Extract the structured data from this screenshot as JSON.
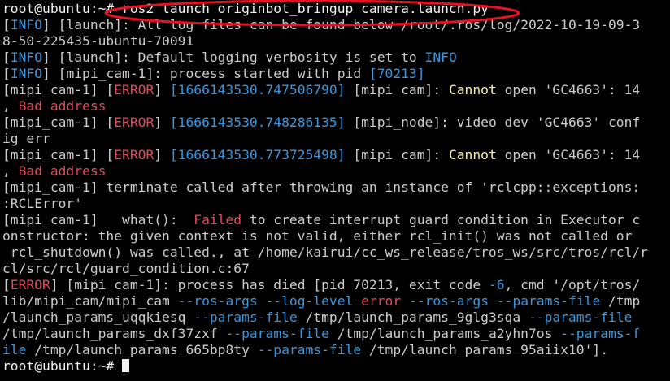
{
  "colors": {
    "background": "#000000",
    "default_text": "#cccccc",
    "bright_text": "#f2f2f2",
    "cyan": "#3a96dd",
    "red": "#e74856",
    "yellow": "#f9f1a5",
    "annotation_red": "#e81123"
  },
  "terminal": {
    "lines": [
      [
        {
          "t": "root@ubuntu:~# ",
          "c": "prompt"
        },
        {
          "t": "ros2 launch originbot_bringup camera.launch.py",
          "c": "white"
        }
      ],
      [
        {
          "t": "[",
          "c": "default"
        },
        {
          "t": "INFO",
          "c": "cyan"
        },
        {
          "t": "] [launch]: All log files can be found below /root/.ros/log/2022-10-19-09-3",
          "c": "default"
        }
      ],
      [
        {
          "t": "8-50-225435-ubuntu-70091",
          "c": "default"
        }
      ],
      [
        {
          "t": "[",
          "c": "default"
        },
        {
          "t": "INFO",
          "c": "cyan"
        },
        {
          "t": "] [launch]: Default logging verbosity is set to ",
          "c": "default"
        },
        {
          "t": "INFO",
          "c": "cyan"
        }
      ],
      [
        {
          "t": "[",
          "c": "default"
        },
        {
          "t": "INFO",
          "c": "cyan"
        },
        {
          "t": "] [mipi_cam-1]: process started with pid ",
          "c": "default"
        },
        {
          "t": "[70213]",
          "c": "cyan"
        }
      ],
      [
        {
          "t": "[mipi_cam-1] [",
          "c": "default"
        },
        {
          "t": "ERROR",
          "c": "red"
        },
        {
          "t": "] ",
          "c": "default"
        },
        {
          "t": "[1666143530.747506790]",
          "c": "cyan"
        },
        {
          "t": " [mipi_cam]: ",
          "c": "default"
        },
        {
          "t": "Cannot",
          "c": "yellow"
        },
        {
          "t": " open 'GC4663': 14",
          "c": "default"
        }
      ],
      [
        {
          "t": ", ",
          "c": "default"
        },
        {
          "t": "Bad address",
          "c": "red"
        }
      ],
      [
        {
          "t": "[mipi_cam-1] [",
          "c": "default"
        },
        {
          "t": "ERROR",
          "c": "red"
        },
        {
          "t": "] ",
          "c": "default"
        },
        {
          "t": "[1666143530.748286135]",
          "c": "cyan"
        },
        {
          "t": " [mipi_node]: video dev 'GC4663' conf",
          "c": "default"
        }
      ],
      [
        {
          "t": "ig err",
          "c": "default"
        }
      ],
      [
        {
          "t": "[mipi_cam-1] [",
          "c": "default"
        },
        {
          "t": "ERROR",
          "c": "red"
        },
        {
          "t": "] ",
          "c": "default"
        },
        {
          "t": "[1666143530.773725498]",
          "c": "cyan"
        },
        {
          "t": " [mipi_cam]: ",
          "c": "default"
        },
        {
          "t": "Cannot",
          "c": "yellow"
        },
        {
          "t": " open 'GC4663': 14",
          "c": "default"
        }
      ],
      [
        {
          "t": ", ",
          "c": "default"
        },
        {
          "t": "Bad address",
          "c": "red"
        }
      ],
      [
        {
          "t": "[mipi_cam-1] terminate called after throwing an instance of 'rclcpp::exceptions:",
          "c": "default"
        }
      ],
      [
        {
          "t": ":RCLError'",
          "c": "default"
        }
      ],
      [
        {
          "t": "[mipi_cam-1]   what():  ",
          "c": "default"
        },
        {
          "t": "Failed",
          "c": "red"
        },
        {
          "t": " to create interrupt guard condition in Executor c",
          "c": "default"
        }
      ],
      [
        {
          "t": "onstructor: the given context is not valid, either rcl_init() was not called or",
          "c": "default"
        }
      ],
      [
        {
          "t": " rcl_shutdown() was called., at /home/kairui/cc_ws_release/tros_ws/src/tros/rcl/r",
          "c": "default"
        }
      ],
      [
        {
          "t": "cl/src/rcl/guard_condition.c:67",
          "c": "default"
        }
      ],
      [
        {
          "t": "[",
          "c": "default"
        },
        {
          "t": "ERROR",
          "c": "red"
        },
        {
          "t": "] [mipi_cam-1]: process has died [pid 70213, exit code ",
          "c": "default"
        },
        {
          "t": "-6",
          "c": "cyan"
        },
        {
          "t": ", cmd '/opt/tros/",
          "c": "default"
        }
      ],
      [
        {
          "t": "lib/mipi_cam/mipi_cam ",
          "c": "default"
        },
        {
          "t": "--ros-args",
          "c": "cyan"
        },
        {
          "t": " ",
          "c": "default"
        },
        {
          "t": "--log-level",
          "c": "cyan"
        },
        {
          "t": " ",
          "c": "default"
        },
        {
          "t": "error",
          "c": "red"
        },
        {
          "t": " ",
          "c": "default"
        },
        {
          "t": "--ros-args",
          "c": "cyan"
        },
        {
          "t": " ",
          "c": "default"
        },
        {
          "t": "--params-file",
          "c": "cyan"
        },
        {
          "t": " /tmp",
          "c": "default"
        }
      ],
      [
        {
          "t": "/launch_params_uqqkiesq ",
          "c": "default"
        },
        {
          "t": "--params-file",
          "c": "cyan"
        },
        {
          "t": " /tmp/launch_params_9glg3sqa ",
          "c": "default"
        },
        {
          "t": "--params-file",
          "c": "cyan"
        }
      ],
      [
        {
          "t": "/tmp/launch_params_dxf37zxf ",
          "c": "default"
        },
        {
          "t": "--params-file",
          "c": "cyan"
        },
        {
          "t": " /tmp/launch_params_a2yhn7os ",
          "c": "default"
        },
        {
          "t": "--params-f",
          "c": "cyan"
        }
      ],
      [
        {
          "t": "ile",
          "c": "cyan"
        },
        {
          "t": " /tmp/launch_params_665bp8ty ",
          "c": "default"
        },
        {
          "t": "--params-file",
          "c": "cyan"
        },
        {
          "t": " /tmp/launch_params_95aiix10'].",
          "c": "default"
        }
      ],
      [
        {
          "t": "root@ubuntu:~# ",
          "c": "prompt"
        }
      ]
    ]
  }
}
